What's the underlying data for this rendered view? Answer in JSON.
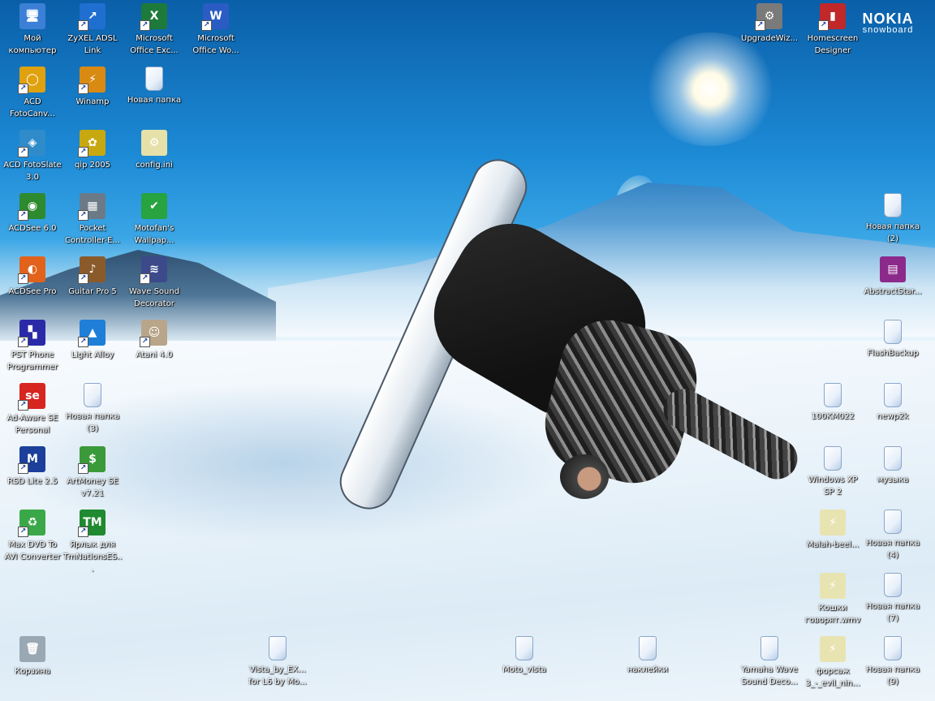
{
  "brand": {
    "title": "NOKIA",
    "subtitle": "snowboard"
  },
  "icons": [
    {
      "id": "my-computer",
      "label": "Мой\nкомпьютер",
      "icon": "computer-icon",
      "color": "#3b7fd6",
      "glyph": "🖥"
    },
    {
      "id": "zyxel",
      "label": "ZyXEL ADSL\nLink",
      "icon": "network-icon",
      "color": "#1f6fd0",
      "glyph": "↗"
    },
    {
      "id": "excel",
      "label": "Microsoft\nOffice Exc...",
      "icon": "excel-icon",
      "color": "#1d7a3a",
      "glyph": "X"
    },
    {
      "id": "word",
      "label": "Microsoft\nOffice Wo...",
      "icon": "word-icon",
      "color": "#2a5cc4",
      "glyph": "W"
    },
    {
      "id": "upgradewiz",
      "label": "UpgradeWiz...",
      "icon": "wizard-icon",
      "color": "#7a7a7a",
      "glyph": "⚙"
    },
    {
      "id": "homescreen",
      "label": "Homescreen\nDesigner",
      "icon": "phone-icon",
      "color": "#c0282a",
      "glyph": "▮"
    },
    {
      "id": "acd-fotocanvas",
      "label": "ACD\nFotoCanv...",
      "icon": "acd-ring-icon",
      "color": "#e0a10e",
      "glyph": "◯"
    },
    {
      "id": "winamp",
      "label": "Winamp",
      "icon": "winamp-icon",
      "color": "#d88a12",
      "glyph": "⚡"
    },
    {
      "id": "new-folder",
      "label": "Новая папка",
      "icon": "folder-icon",
      "color": "#ffffff",
      "glyph": ""
    },
    {
      "id": "acd-fotoslate",
      "label": "ACD FotoSlate\n3.0",
      "icon": "fotoslate-icon",
      "color": "#2f8bc9",
      "glyph": "◈"
    },
    {
      "id": "qip",
      "label": "qip 2005",
      "icon": "qip-flower-icon",
      "color": "#c8a810",
      "glyph": "✿"
    },
    {
      "id": "config",
      "label": "config.ini",
      "icon": "ini-file-icon",
      "color": "#e6e1a8",
      "glyph": "⚙"
    },
    {
      "id": "acdsee6",
      "label": "ACDSee 6.0",
      "icon": "eye-icon",
      "color": "#2e8a2e",
      "glyph": "◉"
    },
    {
      "id": "pocket-controller",
      "label": "Pocket\nController-E...",
      "icon": "pda-icon",
      "color": "#6c7a88",
      "glyph": "▦"
    },
    {
      "id": "motofan",
      "label": "Motofan's\nWallpap...",
      "icon": "green-check-icon",
      "color": "#27a33f",
      "glyph": "✔"
    },
    {
      "id": "new-folder-2",
      "label": "Новая папка\n(2)",
      "icon": "folder-icon",
      "color": "#ffffff",
      "glyph": ""
    },
    {
      "id": "acdsee-pro",
      "label": "ACDSee Pro",
      "icon": "acdsee-pro-icon",
      "color": "#e2621b",
      "glyph": "◐"
    },
    {
      "id": "guitar-pro",
      "label": "Guitar Pro 5",
      "icon": "guitar-pro-icon",
      "color": "#8a5a2b",
      "glyph": "♪"
    },
    {
      "id": "wave-sound",
      "label": "Wave Sound\nDecorator",
      "icon": "sound-wave-icon",
      "color": "#3c4a8a",
      "glyph": "≋"
    },
    {
      "id": "abstract-star",
      "label": "AbstractStar...",
      "icon": "winrar-icon",
      "color": "#8c2a8c",
      "glyph": "▤"
    },
    {
      "id": "pst-phone",
      "label": "PST Phone\nProgrammer",
      "icon": "pst-grid-icon",
      "color": "#2a2aa8",
      "glyph": "▚"
    },
    {
      "id": "light-alloy",
      "label": "Light Alloy",
      "icon": "light-alloy-icon",
      "color": "#1f7fd8",
      "glyph": "▲"
    },
    {
      "id": "atani",
      "label": "Atani 4.0",
      "icon": "alien-head-icon",
      "color": "#b8a58a",
      "glyph": "☺"
    },
    {
      "id": "flashbackup",
      "label": "FlashBackup",
      "icon": "folder-icon",
      "color": "#ffffff",
      "glyph": ""
    },
    {
      "id": "adaware",
      "label": "Ad-Aware SE\nPersonal",
      "icon": "adaware-icon",
      "color": "#d6261f",
      "glyph": "se"
    },
    {
      "id": "new-folder-3",
      "label": "Новая папка\n(3)",
      "icon": "folder-icon",
      "color": "#ffffff",
      "glyph": ""
    },
    {
      "id": "folder-100km",
      "label": "100KM022",
      "icon": "folder-icon",
      "color": "#ffffff",
      "glyph": ""
    },
    {
      "id": "folder-newp2k",
      "label": "newp2k",
      "icon": "folder-icon",
      "color": "#ffffff",
      "glyph": ""
    },
    {
      "id": "rsd-lite",
      "label": "RSD Lite 2.5",
      "icon": "motorola-icon",
      "color": "#1b3f9a",
      "glyph": "M"
    },
    {
      "id": "artmoney",
      "label": "ArtMoney SE\nv7.21",
      "icon": "money-icon",
      "color": "#3a9a3a",
      "glyph": "$"
    },
    {
      "id": "windows-xp-sp2",
      "label": "Windows XP\nSP 2",
      "icon": "folder-icon",
      "color": "#ffffff",
      "glyph": ""
    },
    {
      "id": "music",
      "label": "музыка",
      "icon": "folder-icon",
      "color": "#ffffff",
      "glyph": ""
    },
    {
      "id": "max-dvd",
      "label": "Max DVD To\nAVI Converter",
      "icon": "recycle-arrows-icon",
      "color": "#3aa848",
      "glyph": "♻"
    },
    {
      "id": "tmnations",
      "label": "Ярлык для\nTmNationsES...",
      "icon": "tm-logo-icon",
      "color": "#1f8a2f",
      "glyph": "TM"
    },
    {
      "id": "malah-beel",
      "label": "Malah-beel...",
      "icon": "media-file-icon",
      "color": "#e8e4b2",
      "glyph": "⚡"
    },
    {
      "id": "new-folder-4",
      "label": "Новая папка\n(4)",
      "icon": "folder-icon",
      "color": "#ffffff",
      "glyph": ""
    },
    {
      "id": "koshki",
      "label": "Кошки\nговорят.wmv",
      "icon": "media-file-icon",
      "color": "#e8e4b2",
      "glyph": "⚡"
    },
    {
      "id": "new-folder-7",
      "label": "Новая папка\n(7)",
      "icon": "folder-icon",
      "color": "#ffffff",
      "glyph": ""
    },
    {
      "id": "recycle-bin",
      "label": "Корзина",
      "icon": "recycle-bin-icon",
      "color": "#9aa8b4",
      "glyph": "🗑"
    },
    {
      "id": "vista-by-ex",
      "label": "Vista_by_EX...\nfor L6 by Mo...",
      "icon": "folder-icon",
      "color": "#ffffff",
      "glyph": ""
    },
    {
      "id": "moto-vista",
      "label": "Moto_vista",
      "icon": "folder-icon",
      "color": "#ffffff",
      "glyph": ""
    },
    {
      "id": "stickers",
      "label": "наклейки",
      "icon": "folder-icon",
      "color": "#ffffff",
      "glyph": ""
    },
    {
      "id": "yamaha-wave",
      "label": "Yamaha Wave\nSound Deco...",
      "icon": "folder-icon",
      "color": "#ffffff",
      "glyph": ""
    },
    {
      "id": "forsazh",
      "label": "форсаж\n3_-_evil_nin...",
      "icon": "media-file-icon",
      "color": "#e8e4b2",
      "glyph": "⚡"
    },
    {
      "id": "new-folder-9",
      "label": "Новая папка\n(9)",
      "icon": "folder-icon",
      "color": "#ffffff",
      "glyph": ""
    }
  ]
}
